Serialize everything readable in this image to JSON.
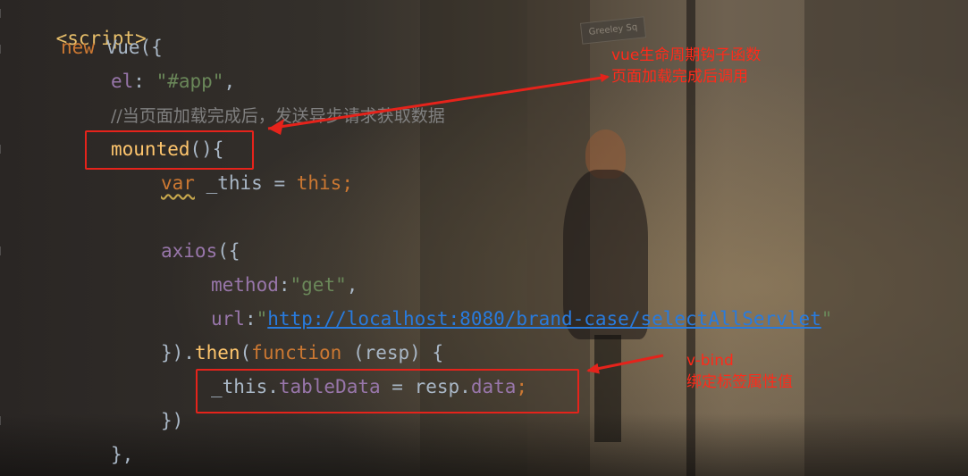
{
  "code_lines": {
    "l1": {
      "tag": "<script>"
    },
    "l2": {
      "kw": "new",
      "cls": "Vue",
      "punct": "({"
    },
    "l3": {
      "prop": "el",
      "colon": ": ",
      "str": "\"#app\"",
      "comma": ","
    },
    "l4": {
      "comment": "//当页面加载完成后，发送异步请求获取数据"
    },
    "l5": {
      "fn": "mounted",
      "punct": "(){"
    },
    "l6": {
      "kw": "var",
      "ident": " _this = ",
      "kw2": "this",
      "semi": ";"
    },
    "l7": {
      "fn": "axios",
      "punct": "({"
    },
    "l8": {
      "prop": "method",
      "colon": ":",
      "str": "\"get\"",
      "comma": ","
    },
    "l9": {
      "prop": "url",
      "colon": ":",
      "q1": "\"",
      "url": "http://localhost:8080/brand-case/selectAllServlet",
      "q2": "\""
    },
    "l10": {
      "p1": "}).",
      "then": "then",
      "p2": "(",
      "kw": "function",
      "p3": " (resp) {"
    },
    "l11": {
      "a": "_this.",
      "p1": "tableData",
      "b": " = resp.",
      "p2": "data",
      "semi": ";"
    },
    "l12": {
      "punct": "})"
    },
    "l13": {
      "punct": "},"
    }
  },
  "annotations": {
    "top": {
      "line1": "vue生命周期钩子函数",
      "line2": "页面加载完成后调用"
    },
    "bottom": {
      "line1": "v-bind",
      "line2": "绑定标签属性值"
    }
  },
  "background": {
    "street_sign": "Greeley Sq"
  },
  "colors": {
    "annotation": "#e5231b",
    "tag": "#e8bf6a",
    "keyword": "#cc7832",
    "string": "#6a8759",
    "property": "#9876aa",
    "function": "#ffc66d",
    "comment": "#808080",
    "url": "#287bde"
  }
}
